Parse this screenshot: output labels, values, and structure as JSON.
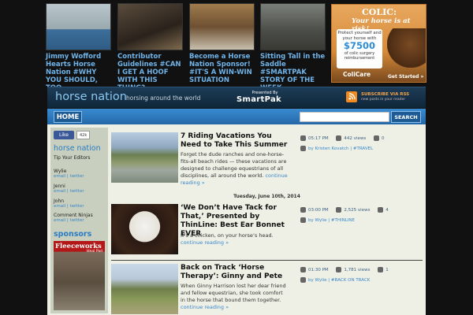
{
  "featured": [
    {
      "caption": "Jimmy Wofford Hearts Horse Nation #WHY YOU SHOULD, TOO"
    },
    {
      "caption": "Contributor Guidelines #CAN I GET A HOOF WITH THIS THING?"
    },
    {
      "caption": "Become a Horse Nation Sponsor! #IT'S A WIN-WIN SITUATION"
    },
    {
      "caption": "Sitting Tall in the Saddle #SMARTPAK STORY OF THE WEEK"
    }
  ],
  "ad": {
    "headline": "COLIC:",
    "subhead": "Your horse is at risk!",
    "box_text": "Protect yourself and your horse with",
    "amount": "$7500",
    "box_sub": "of colic surgery reimbursement",
    "brand": "ColiCare",
    "cta": "Get Started »"
  },
  "header": {
    "logo": "horse nation",
    "tagline": "horsing around the world",
    "presented_by": "Presented By",
    "sponsor": "SmartPak",
    "rss_title": "SUBSCRIBE VIA RSS",
    "rss_sub": "new posts in your reader"
  },
  "nav": {
    "home": "HOME",
    "search_button": "SEARCH",
    "search_placeholder": ""
  },
  "sidebar": {
    "fb_like": "Like",
    "fb_count": "42k",
    "title": "horse nation",
    "editors_label": "Tip Your Editors",
    "editors": [
      {
        "name": "Wylie",
        "links": "email | twitter"
      },
      {
        "name": "Jenni",
        "links": "email | twitter"
      },
      {
        "name": "John",
        "links": "email | twitter"
      },
      {
        "name": "Comment Ninjas",
        "links": "email | twitter"
      }
    ],
    "sponsors_title": "sponsors",
    "fleece_name": "Fleeceworks",
    "fleece_tag": "Ideal Pad"
  },
  "date_sep": "Tuesday, June 10th, 2014",
  "posts": [
    {
      "title": "7 Riding Vacations You Need to Take This Summer",
      "excerpt": "Forget the dude ranches and one-horse-fits-all beach rides — these vacations are designed to challenge equestrians of all disciplines, all around the world.",
      "more": "continue reading »",
      "time": "05:17 PM",
      "views": "442 views",
      "comments": "0",
      "byline": "by Kristen Kovatch | #TRAVEL"
    },
    {
      "title": "‘We Don’t Have Tack for That,’ Presented by ThinLine: Best Ear Bonnet EVER",
      "excerpt": "It’s a chicken, on your horse’s head.",
      "more": "continue reading »",
      "time": "03:00 PM",
      "views": "2,525 views",
      "comments": "4",
      "byline": "by Wylie | #THINLINE"
    },
    {
      "title": "Back on Track ‘Horse Therapy’: Ginny and Pete",
      "excerpt": "When Ginny Harrison lost her dear friend and fellow equestrian, she took comfort in the horse that bound them together.",
      "more": "continue reading »",
      "time": "01:30 PM",
      "views": "1,781 views",
      "comments": "1",
      "byline": "by Wylie | #BACK ON TRACK"
    }
  ]
}
